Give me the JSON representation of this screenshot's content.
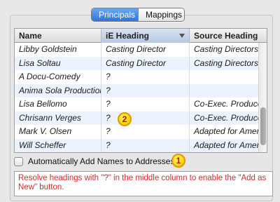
{
  "tabs": {
    "principals": "Principals",
    "mappings": "Mappings"
  },
  "table": {
    "columns": [
      "Name",
      "iE Heading",
      "Source Heading"
    ],
    "rows": [
      [
        "Libby Goldstein",
        "Casting Director",
        "Casting Directors"
      ],
      [
        "Lisa Soltau",
        "Casting Director",
        "Casting Directors"
      ],
      [
        "A Docu-Comedy",
        "?",
        ""
      ],
      [
        "Anima Sola Productions",
        "?",
        ""
      ],
      [
        "Lisa Bellomo",
        "?",
        "Co-Exec. Producer"
      ],
      [
        "Chrisann Verges",
        "?",
        "Co-Exec. Producer"
      ],
      [
        "Mark V. Olsen",
        "?",
        "Adapted for American"
      ],
      [
        "Will Scheffer",
        "?",
        "Adapted for American"
      ]
    ]
  },
  "checkbox": {
    "label": "Automatically Add Names to Addresses",
    "checked": false
  },
  "message": "Resolve headings with \"?\" in the middle column to enable the \"Add as New\" button.",
  "callouts": [
    "1",
    "2"
  ],
  "colors": {
    "accent": "#2f75d9",
    "alert_text": "#d8282b",
    "callout": "#f2d200"
  }
}
